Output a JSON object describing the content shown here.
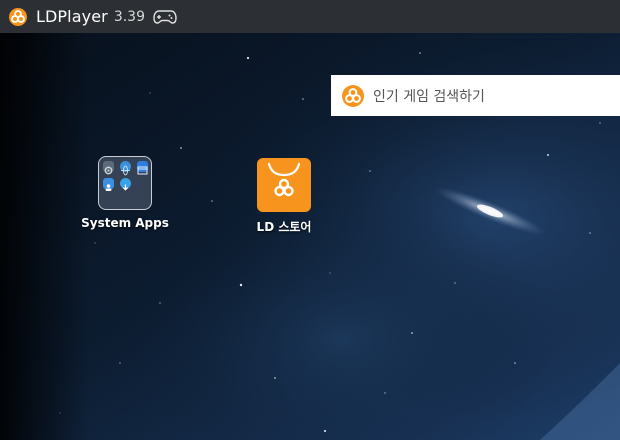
{
  "titlebar": {
    "app_name": "LDPlayer",
    "version": "3.39",
    "logo_icon": "ldplayer-logo-icon",
    "gamepad_icon": "gamepad-icon"
  },
  "search": {
    "placeholder": "인기 게임 검색하기",
    "logo_icon": "ldplayer-logo-icon"
  },
  "desktop_icons": [
    {
      "label": "System Apps",
      "icon": "folder-icon"
    },
    {
      "label": "LD 스토어",
      "icon": "ld-store-icon"
    }
  ],
  "colors": {
    "accent": "#f7941d",
    "titlebar_bg": "#2c2f33",
    "desktop_bg": "#0d1a2c"
  }
}
